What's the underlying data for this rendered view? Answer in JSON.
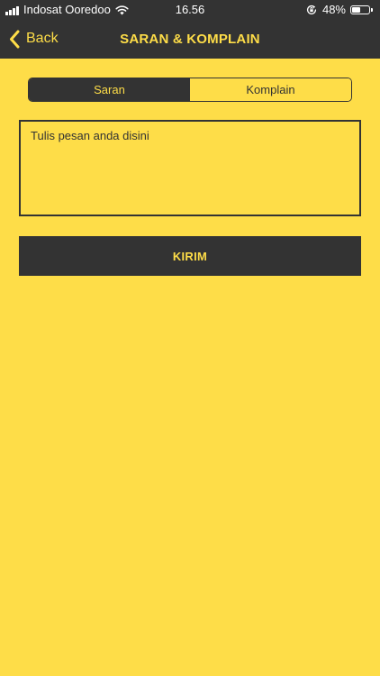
{
  "status_bar": {
    "carrier": "Indosat Ooredoo",
    "time": "16.56",
    "battery_percent": "48%",
    "battery_level": 0.48,
    "icons": [
      "signal-icon",
      "wifi-icon",
      "rotation-lock-icon",
      "battery-icon"
    ]
  },
  "navbar": {
    "back_label": "Back",
    "title": "SARAN & KOMPLAIN"
  },
  "segmented_control": {
    "options": [
      "Saran",
      "Komplain"
    ],
    "selected": "Saran"
  },
  "message": {
    "placeholder": "Tulis pesan anda disini"
  },
  "submit": {
    "label": "KIRIM"
  },
  "colors": {
    "background": "#FEDD48",
    "dark": "#333333",
    "accent": "#FEDD48",
    "status_text": "#FFFFFF"
  }
}
